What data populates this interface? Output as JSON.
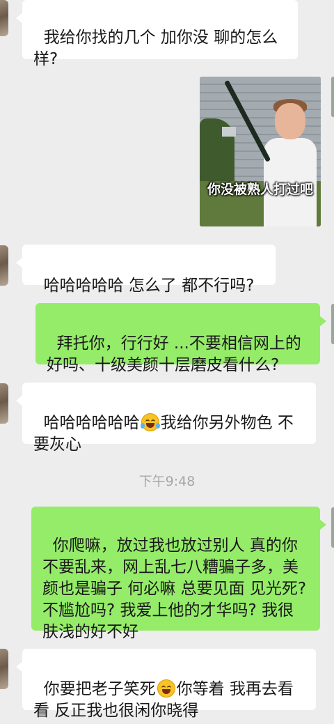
{
  "messages": [
    {
      "side": "left",
      "text": "我给你找的几个 加你没 聊的怎么样?"
    },
    {
      "side": "left",
      "type": "image",
      "caption": "你没被熟人打过吧"
    },
    {
      "side": "left",
      "text": "哈哈哈哈哈 怎么了 都不行吗?"
    },
    {
      "side": "right",
      "text": "拜托你，行行好 ...不要相信网上的好吗、十级美颜十层磨皮看什么?"
    },
    {
      "side": "left",
      "text_before_emoji": "哈哈哈哈哈哈",
      "emoji": "face-with-tears-of-joy",
      "text_after_emoji": "我给你另外物色 不要灰心"
    },
    {
      "side": "right",
      "text": "你爬嘛，放过我也放过别人 真的你不要乱来，网上乱七八糟骗子多，美颜也是骗子 何必嘛 总要见面 见光死? 不尴尬吗? 我爱上他的才华吗? 我很肤浅的好不好"
    },
    {
      "side": "left",
      "text_before_emoji": "你要把老子笑死",
      "emoji": "grinning-squinting-face",
      "text_after_emoji": "你等着 我再去看看 反正我也很闲你晓得"
    }
  ],
  "timestamp": "下午9:48",
  "colors": {
    "background": "#ededed",
    "bubble_left": "#ffffff",
    "bubble_right": "#95ec69",
    "timestamp": "#a6a6a6"
  }
}
